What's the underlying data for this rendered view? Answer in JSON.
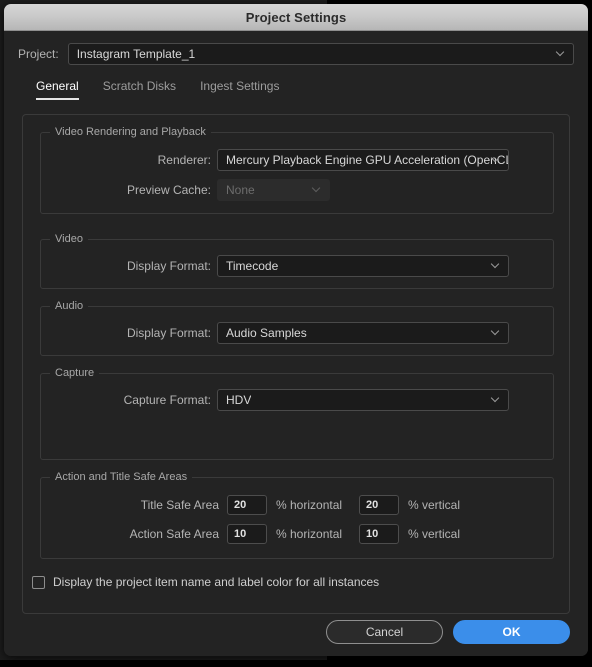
{
  "window": {
    "title": "Project Settings"
  },
  "project": {
    "label": "Project:",
    "value": "Instagram Template_1",
    "chevron_icon": "chevron-down-icon"
  },
  "tabs": [
    {
      "label": "General",
      "active": true
    },
    {
      "label": "Scratch Disks",
      "active": false
    },
    {
      "label": "Ingest Settings",
      "active": false
    }
  ],
  "groups": {
    "video_rendering": {
      "title": "Video Rendering and Playback",
      "renderer": {
        "label": "Renderer:",
        "value": "Mercury Playback Engine GPU Acceleration (OpenCL)",
        "enabled": true
      },
      "preview_cache": {
        "label": "Preview Cache:",
        "value": "None",
        "enabled": false
      }
    },
    "video": {
      "title": "Video",
      "display_format": {
        "label": "Display Format:",
        "value": "Timecode"
      }
    },
    "audio": {
      "title": "Audio",
      "display_format": {
        "label": "Display Format:",
        "value": "Audio Samples"
      }
    },
    "capture": {
      "title": "Capture",
      "capture_format": {
        "label": "Capture Format:",
        "value": "HDV"
      }
    },
    "safe_areas": {
      "title": "Action and Title Safe Areas",
      "title_safe": {
        "label": "Title Safe Area",
        "horizontal_value": "20",
        "horizontal_unit": "% horizontal",
        "vertical_value": "20",
        "vertical_unit": "% vertical"
      },
      "action_safe": {
        "label": "Action Safe Area",
        "horizontal_value": "10",
        "horizontal_unit": "% horizontal",
        "vertical_value": "10",
        "vertical_unit": "% vertical"
      }
    }
  },
  "display_checkbox": {
    "label": "Display the project item name and label color for all instances",
    "checked": false
  },
  "footer": {
    "cancel_label": "Cancel",
    "ok_label": "OK"
  },
  "colors": {
    "accent": "#3b8eea",
    "dialog_bg": "#232323",
    "titlebar_top": "#d6d6d6",
    "field_bg": "#1b1b1b",
    "border": "#3a3a3a"
  }
}
